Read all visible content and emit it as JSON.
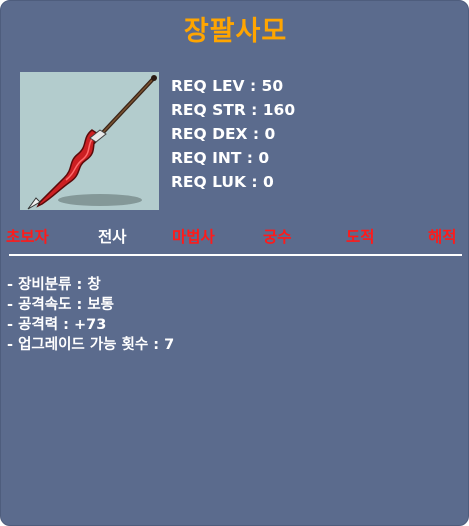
{
  "item": {
    "name": "장팔사모",
    "icon": "spear-icon"
  },
  "requirements": [
    "REQ LEV : 50",
    "REQ STR : 160",
    "REQ DEX : 0",
    "REQ INT : 0",
    "REQ LUK : 0"
  ],
  "jobs": [
    {
      "label": "초보자",
      "allowed": false
    },
    {
      "label": "전사",
      "allowed": true
    },
    {
      "label": "마법사",
      "allowed": false
    },
    {
      "label": "궁수",
      "allowed": false
    },
    {
      "label": "도적",
      "allowed": false
    },
    {
      "label": "해적",
      "allowed": false
    }
  ],
  "stats": [
    "- 장비분류 : 창",
    "- 공격속도 : 보통",
    "- 공격력 : +73",
    "- 업그레이드 가능 횟수 : 7"
  ],
  "colors": {
    "background": "#5b6b8d",
    "title": "#ffa500",
    "restricted_job": "#ff1a1a",
    "allowed_job": "#ffffff",
    "icon_background": "#b3cccd"
  }
}
